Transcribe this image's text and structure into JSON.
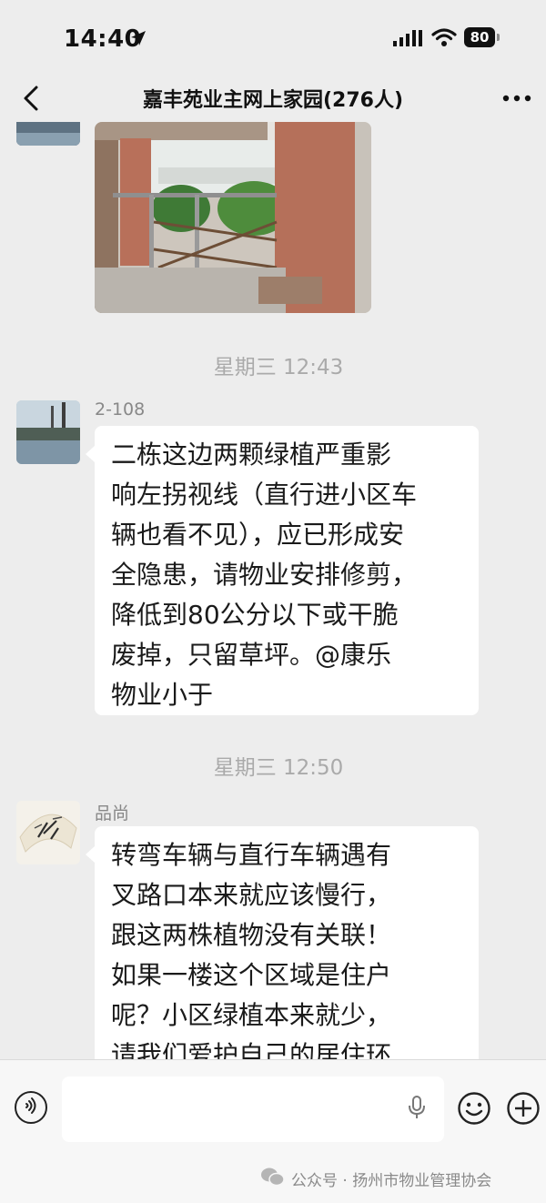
{
  "status_bar": {
    "time": "14:40",
    "battery": "80"
  },
  "header": {
    "title": "嘉丰苑业主网上家园(276人)"
  },
  "messages": [
    {
      "type": "image",
      "description": ""
    },
    {
      "type": "timestamp",
      "text": "星期三 12:43"
    },
    {
      "type": "text",
      "sender": "2-108",
      "text": "二栋这边两颗绿植严重影\n响左拐视线（直行进小区车\n辆也看不见），应已形成安\n全隐患，请物业安排修剪，\n降低到80公分以下或干脆\n废掉，只留草坪。@康乐\n物业小于"
    },
    {
      "type": "timestamp",
      "text": "星期三 12:50"
    },
    {
      "type": "text",
      "sender": "品尚",
      "text": "转弯车辆与直行车辆遇有\n叉路口本来就应该慢行，\n跟这两株植物没有关联！\n如果一楼这个区域是住户\n呢？小区绿植本来就少，\n请我们爱护自己的居住环"
    }
  ],
  "input": {
    "placeholder": ""
  },
  "watermark": {
    "text": "公众号 · 扬州市物业管理协会"
  },
  "icons": [
    "location-arrow-icon",
    "signal-icon",
    "wifi-icon",
    "battery-icon",
    "back-chevron-icon",
    "more-icon",
    "voice-icon",
    "microphone-icon",
    "emoji-icon",
    "plus-icon",
    "wechat-logo-icon"
  ],
  "colors": {
    "background": "#ededed",
    "bubble": "#ffffff",
    "timestamp": "#aaaaaa",
    "sender": "#888888"
  }
}
